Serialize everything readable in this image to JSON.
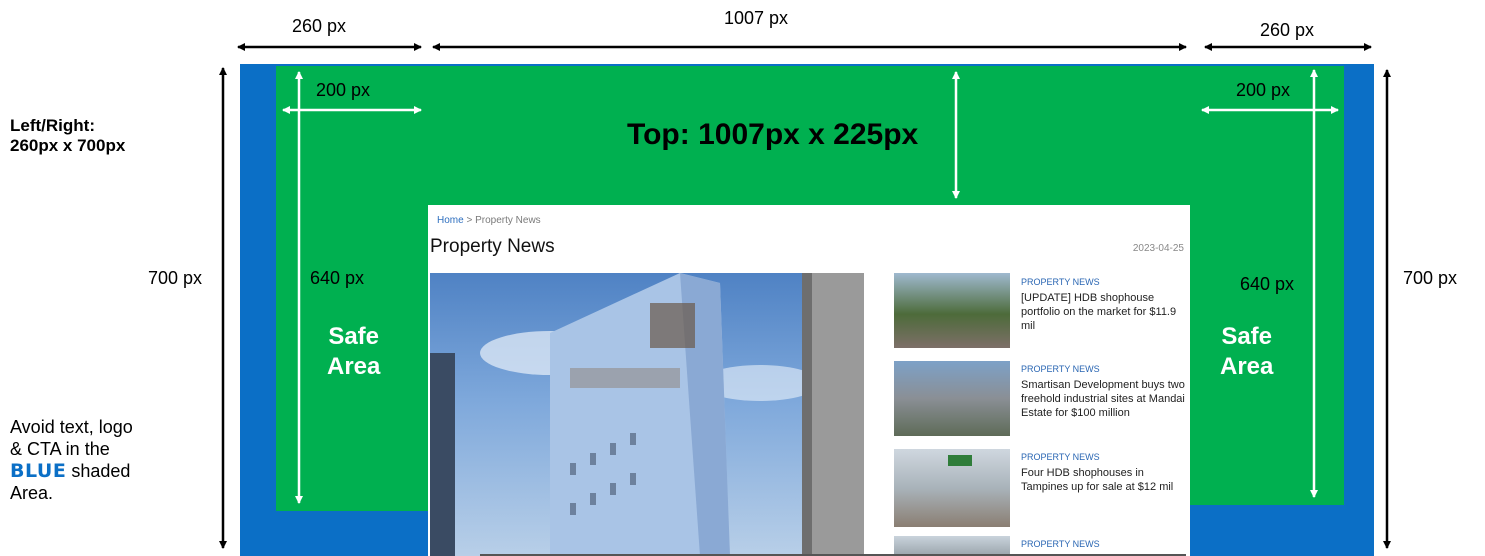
{
  "dimensions": {
    "side_width": "260 px",
    "center_width": "1007 px",
    "side_width_right": "260 px",
    "safe_width_left": "200 px",
    "safe_width_right": "200 px",
    "height_left": "700 px",
    "height_right": "700 px",
    "safe_height_left": "640 px",
    "safe_height_right": "640 px"
  },
  "labels": {
    "top_area": "Top: 1007px x 225px",
    "left_right_line1": "Left/Right:",
    "left_right_line2": "260px x 700px",
    "safe_line1": "Safe",
    "safe_line2": "Area",
    "avoid_line1": "Avoid text, logo",
    "avoid_line2": "& CTA in the",
    "avoid_blue": "BLUE",
    "avoid_line3_rest": " shaded",
    "avoid_line4": "Area."
  },
  "colors": {
    "blue_shaded": "#0B6FC6",
    "green_safe": "#00B050"
  },
  "website": {
    "breadcrumb_home": "Home",
    "breadcrumb_sep": " > ",
    "breadcrumb_current": "Property News",
    "page_title": "Property News",
    "date": "2023-04-25",
    "news": [
      {
        "category": "PROPERTY NEWS",
        "title": "[UPDATE] HDB shophouse portfolio on the market for $11.9 mil"
      },
      {
        "category": "PROPERTY NEWS",
        "title": "Smartisan Development buys two freehold industrial sites at Mandai Estate for $100 million"
      },
      {
        "category": "PROPERTY NEWS",
        "title": "Four HDB shophouses in Tampines up for sale at $12 mil"
      },
      {
        "category": "PROPERTY NEWS",
        "title": ""
      }
    ]
  },
  "icons": [
    "double-arrow-icon",
    "building-photo-icon"
  ]
}
